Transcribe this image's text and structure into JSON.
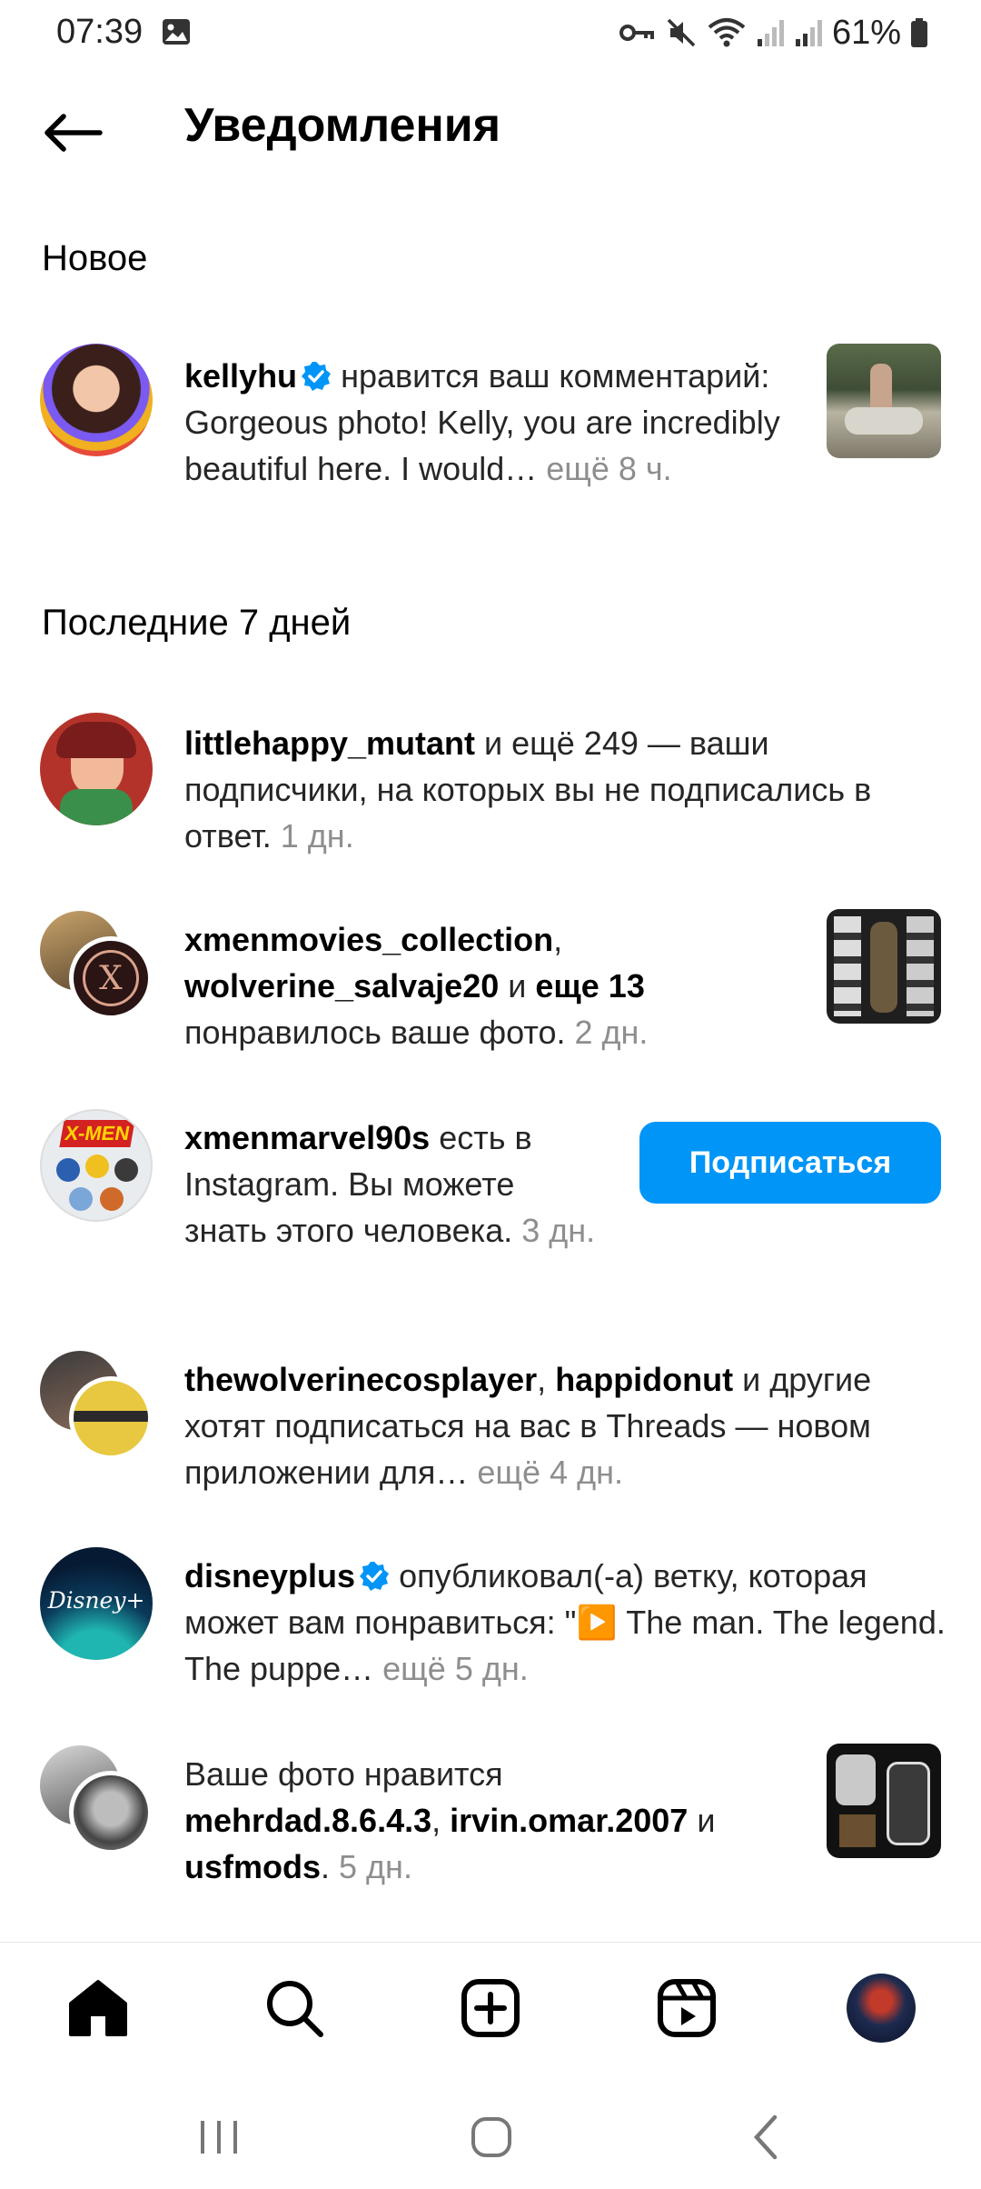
{
  "status_bar": {
    "time": "07:39",
    "battery": "61%"
  },
  "header": {
    "title": "Уведомления"
  },
  "sections": {
    "new": "Новое",
    "last7": "Последние 7 дней"
  },
  "notifications": [
    {
      "user": "kellyhu",
      "text_a": " нравится ваш комментарий: Gorgeous photo! Kelly, you are incredibly beautiful here. I would… ",
      "more_time": "ещё 8 ч."
    },
    {
      "user": "littlehappy_mutant",
      "text_a": " и ещё 249 — ваши подписчики, на которых вы не подписались в ответ. ",
      "time": "1 дн."
    },
    {
      "user1": "xmenmovies_collection",
      "sep": ",",
      "user2": "wolverine_salvaje20",
      "and": " и ",
      "others": "еще 13",
      "text_b": "понравилось ваше фото. ",
      "time": "2 дн."
    },
    {
      "user": "xmenmarvel90s",
      "text_a": " есть в Instagram. Вы можете знать этого человека. ",
      "time": "3 дн.",
      "button": "Подписаться"
    },
    {
      "user1": "thewolverinecosplayer",
      "sep": ", ",
      "user2": "happidonut",
      "text_a": " и другие хотят подписаться на вас в Threads — новом приложении для… ",
      "more_time": "ещё 4 дн."
    },
    {
      "user": "disneyplus",
      "text_a": " опубликовал(-а) ветку, которая может вам понравиться: \"▶️ The man. The legend. The puppe… ",
      "more_time": "ещё 5 дн.",
      "avatar_label": "Disney+"
    },
    {
      "text_pre": "Ваше фото нравится ",
      "user1": "mehrdad.8.6.4.3",
      "sep": ", ",
      "user2": "irvin.omar.2007",
      "and": " и ",
      "user3": "usfmods",
      "text_end": ". ",
      "time": "5 дн."
    }
  ],
  "icons": {
    "back": "arrow-left-icon",
    "home": "home-icon",
    "search": "search-icon",
    "create": "plus-square-icon",
    "reels": "reels-icon",
    "profile": "profile-avatar"
  },
  "colors": {
    "accent": "#0095f6",
    "verified": "#0095f6",
    "secondary_text": "#8e8e8e"
  }
}
